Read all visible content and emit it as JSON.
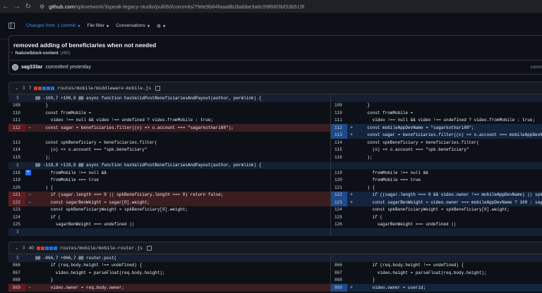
{
  "browser": {
    "url_host": "github.com",
    "url_path": "/spknetwork/3speak-legacy-studio/pull/60/commits/796e9b64faaa8b2babbe3a6c59f66f3bf33b519f"
  },
  "toolbar": {
    "changes_label": "Changes from",
    "changes_value": "1 commit",
    "file_filter": "File filter",
    "conversations": "Conversations"
  },
  "commit": {
    "title": "removed adding of beneficiaries when not needed",
    "branch": "feature/block-content",
    "pr_ref": "(#60)",
    "author": "sag333ar",
    "meta": "committed yesterday",
    "hash_label": "comm"
  },
  "files": [
    {
      "changes": "7",
      "path": "routes/mobile/middleware-mobile.js",
      "hunks": [
        "@@ -109,7 +109,8 @@ async function hasValidPostBeneficiariesAndPayout(author, permlink) {",
        "@@ -118,8 +119,8 @@ async function hasValidPostBeneficiariesAndPayout(author, permlink) {"
      ],
      "left_rows": [
        {
          "n": "109",
          "s": "",
          "t": "ctx",
          "c": "    }"
        },
        {
          "n": "110",
          "s": "",
          "t": "ctx",
          "c": "    const fromMobile ="
        },
        {
          "n": "111",
          "s": "",
          "t": "ctx",
          "c": "      video !== null && video !== undefined ? video.fromMobile : true;"
        },
        {
          "n": "112",
          "s": "−",
          "t": "del",
          "c": "    const sagar = beneficiaries.filter((o) => o.account === \"sagarkothari88\");"
        },
        {
          "n": "",
          "s": "",
          "t": "empty",
          "c": ""
        },
        {
          "n": "113",
          "s": "",
          "t": "ctx",
          "c": "    const spkBeneficiary = beneficiaries.filter("
        },
        {
          "n": "114",
          "s": "",
          "t": "ctx",
          "c": "      (o) => o.account === \"spk.beneficiary\""
        },
        {
          "n": "115",
          "s": "",
          "t": "ctx",
          "c": "    );"
        }
      ],
      "right_rows": [
        {
          "n": "109",
          "s": "",
          "t": "ctx",
          "c": "    }"
        },
        {
          "n": "110",
          "s": "",
          "t": "ctx",
          "c": "    const fromMobile ="
        },
        {
          "n": "111",
          "s": "",
          "t": "ctx",
          "c": "      video !== null && video !== undefined ? video.fromMobile : true;"
        },
        {
          "n": "112",
          "s": "+",
          "t": "add",
          "c": "    const mobileAppDevName = \"sagarkothari88\";"
        },
        {
          "n": "113",
          "s": "+",
          "t": "add",
          "c": "    const sagar = beneficiaries.filter((o) => o.account === mobileAppDevNam"
        },
        {
          "n": "114",
          "s": "",
          "t": "ctx",
          "c": "    const spkBeneficiary = beneficiaries.filter("
        },
        {
          "n": "115",
          "s": "",
          "t": "ctx",
          "c": "      (o) => o.account === \"spk.beneficiary\""
        },
        {
          "n": "116",
          "s": "",
          "t": "ctx",
          "c": "    );"
        }
      ],
      "left_rows2": [
        {
          "n": "118",
          "s": "",
          "t": "ctx",
          "c": "      fromMobile !== null &&"
        },
        {
          "n": "119",
          "s": "",
          "t": "ctx",
          "c": "      fromMobile === true"
        },
        {
          "n": "120",
          "s": "",
          "t": "ctx",
          "c": "    ) {"
        },
        {
          "n": "121",
          "s": "−",
          "t": "del",
          "c": "      if (sagar.length === 0 || spkBeneficiary.length === 0) return false;"
        },
        {
          "n": "122",
          "s": "−",
          "t": "del",
          "c": "      const sagarBenWeight = sagar[0].weight;"
        },
        {
          "n": "123",
          "s": "",
          "t": "ctx",
          "c": "      const spkBeneficiaryWeight = spkBeneficiary[0].weight;"
        },
        {
          "n": "124",
          "s": "",
          "t": "ctx",
          "c": "      if ("
        },
        {
          "n": "125",
          "s": "",
          "t": "ctx",
          "c": "        sagarBenWeight === undefined ||"
        }
      ],
      "right_rows2": [
        {
          "n": "119",
          "s": "",
          "t": "ctx",
          "c": "      fromMobile !== null &&"
        },
        {
          "n": "120",
          "s": "",
          "t": "ctx",
          "c": "      fromMobile === true"
        },
        {
          "n": "121",
          "s": "",
          "t": "ctx",
          "c": "    ) {"
        },
        {
          "n": "122",
          "s": "+",
          "t": "add",
          "c": "      if ((sagar.length === 0 && video.owner !== mobileAppDevName) || spkBe"
        },
        {
          "n": "123",
          "s": "+",
          "t": "add",
          "c": "      const sagarBenWeight = video.owner === mobileAppDevName ? 100 : sagar"
        },
        {
          "n": "124",
          "s": "",
          "t": "ctx",
          "c": "      const spkBeneficiaryWeight = spkBeneficiary[0].weight;"
        },
        {
          "n": "125",
          "s": "",
          "t": "ctx",
          "c": "      if ("
        },
        {
          "n": "126",
          "s": "",
          "t": "ctx",
          "c": "        sagarBenWeight === undefined ||"
        }
      ]
    },
    {
      "changes": "40",
      "path": "routes/mobile/mobile-router.js",
      "hunk": "@@ -866,7 +866,7 @@ router.post(",
      "left_rows": [
        {
          "n": "866",
          "s": "",
          "t": "ctx",
          "c": "      if (req.body.height !== undefined) {"
        },
        {
          "n": "867",
          "s": "",
          "t": "ctx",
          "c": "        video.height = parseFloat(req.body.height);"
        },
        {
          "n": "868",
          "s": "",
          "t": "ctx",
          "c": "      }"
        },
        {
          "n": "869",
          "s": "−",
          "t": "del",
          "c": "      video.owner = req.body.owner;"
        }
      ],
      "right_rows": [
        {
          "n": "866",
          "s": "",
          "t": "ctx",
          "c": "      if (req.body.height !== undefined) {"
        },
        {
          "n": "867",
          "s": "",
          "t": "ctx",
          "c": "        video.height = parseFloat(req.body.height);"
        },
        {
          "n": "868",
          "s": "",
          "t": "ctx",
          "c": "      }"
        },
        {
          "n": "869",
          "s": "+",
          "t": "add",
          "c": "      video.owner = userid;"
        }
      ]
    }
  ]
}
